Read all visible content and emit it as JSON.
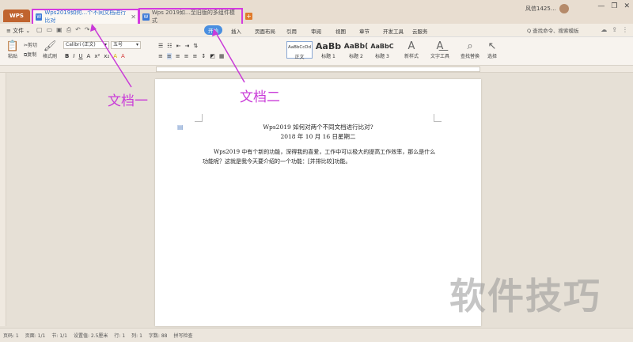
{
  "tabbar": {
    "home_label": "WPS",
    "tabs": [
      {
        "label": "Wps2019如何…个不同文档进行比对"
      },
      {
        "label": "Wps 2019如…至旧版的多组件模式"
      }
    ],
    "new_tab_label": "+",
    "user_name": "风信1425…",
    "window_buttons": [
      "—",
      "❐",
      "✕"
    ]
  },
  "menubar": {
    "file_label": "≡ 文件 ⌄",
    "items": [
      "开始",
      "插入",
      "页面布局",
      "引用",
      "审阅",
      "视图",
      "章节",
      "开发工具",
      "云服务"
    ],
    "search_placeholder": "Q 查找命令、搜索模板"
  },
  "ribbon": {
    "paste_label": "粘贴",
    "cut_label": "剪切",
    "copy_label": "复制",
    "format_painter_label": "格式刷",
    "font_name": "Calibri (正文)",
    "font_size": "五号",
    "styles": [
      {
        "sample": "AaBbCcDd",
        "label": "正文"
      },
      {
        "sample": "AaBb",
        "label": "标题 1"
      },
      {
        "sample": "AaBb(",
        "label": "标题 2"
      },
      {
        "sample": "AaBbC",
        "label": "标题 3"
      }
    ],
    "new_style_label": "新样式",
    "text_tools_label": "文字工具",
    "find_replace_label": "查找替换",
    "select_label": "选择"
  },
  "document": {
    "title": "Wps2019 如何对两个不同文档进行比对?",
    "date": "2018 年 10 月 16 日星期二",
    "body": "Wps2019 中有个新的功能，深得我的喜爱，工作中可以极大的提高工作效率，那么是什么功能呢？这就是我今天要介绍的一个功能：[并排比较]功能。"
  },
  "annotations": {
    "doc1": "文档一",
    "doc2": "文档二"
  },
  "watermark": "软件技巧",
  "statusbar": {
    "items": [
      "页码: 1",
      "页面: 1/1",
      "节: 1/1",
      "设置值: 2.5厘米",
      "行: 1",
      "列: 1",
      "字数: 88",
      "拼写检查"
    ]
  },
  "colors": {
    "accent": "#4a8fe0",
    "annotation": "#c93ad8",
    "wps_brand": "#c0642f"
  }
}
